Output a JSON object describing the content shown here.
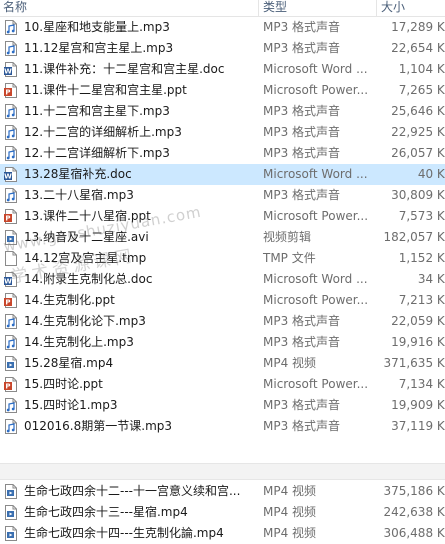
{
  "header": {
    "name": "名称",
    "type": "类型",
    "size": "大小"
  },
  "files": [
    {
      "icon": "audio",
      "name": "10.星座和地支能量上.mp3",
      "type": "MP3 格式声音",
      "size": "17,289 KB"
    },
    {
      "icon": "audio",
      "name": "11.12星宫和宫主星上.mp3",
      "type": "MP3 格式声音",
      "size": "22,654 KB"
    },
    {
      "icon": "word",
      "name": "11.课件补充：十二星宫和宫主星.doc",
      "type": "Microsoft Word ...",
      "size": "1,104 KB"
    },
    {
      "icon": "ppt",
      "name": "11.课件十二星宫和宫主星.ppt",
      "type": "Microsoft Power...",
      "size": "7,265 KB"
    },
    {
      "icon": "audio",
      "name": "11.十二宫和宫主星下.mp3",
      "type": "MP3 格式声音",
      "size": "25,646 KB"
    },
    {
      "icon": "audio",
      "name": "12.十二宫的详细解析上.mp3",
      "type": "MP3 格式声音",
      "size": "22,925 KB"
    },
    {
      "icon": "audio",
      "name": "12.十二宫详细解析下.mp3",
      "type": "MP3 格式声音",
      "size": "26,057 KB"
    },
    {
      "icon": "word",
      "name": "13.28星宿补充.doc",
      "type": "Microsoft Word ...",
      "size": "40 KB"
    },
    {
      "icon": "audio",
      "name": "13.二十八星宿.mp3",
      "type": "MP3 格式声音",
      "size": "30,809 KB"
    },
    {
      "icon": "ppt",
      "name": "13.课件二十八星宿.ppt",
      "type": "Microsoft Power...",
      "size": "7,573 KB"
    },
    {
      "icon": "video",
      "name": "13.纳音及十二星座.avi",
      "type": "视频剪辑",
      "size": "182,057 KB"
    },
    {
      "icon": "generic",
      "name": "14.12宫及宫主星.tmp",
      "type": "TMP 文件",
      "size": "1,152 KB"
    },
    {
      "icon": "word",
      "name": "14.附录生克制化总.doc",
      "type": "Microsoft Word ...",
      "size": "34 KB"
    },
    {
      "icon": "ppt",
      "name": "14.生克制化.ppt",
      "type": "Microsoft Power...",
      "size": "7,213 KB"
    },
    {
      "icon": "audio",
      "name": "14.生克制化论下.mp3",
      "type": "MP3 格式声音",
      "size": "22,059 KB"
    },
    {
      "icon": "audio",
      "name": "14.生克制化上.mp3",
      "type": "MP3 格式声音",
      "size": "19,916 KB"
    },
    {
      "icon": "video",
      "name": "15.28星宿.mp4",
      "type": "MP4 视频",
      "size": "371,635 KB"
    },
    {
      "icon": "ppt",
      "name": "15.四时论.ppt",
      "type": "Microsoft Power...",
      "size": "7,134 KB"
    },
    {
      "icon": "audio",
      "name": "15.四时论1.mp3",
      "type": "MP3 格式声音",
      "size": "19,909 KB"
    },
    {
      "icon": "audio",
      "name": "012016.8期第一节课.mp3",
      "type": "MP3 格式声音",
      "size": "37,119 KB"
    }
  ],
  "files_lower": [
    {
      "icon": "video",
      "name": "生命七政四余十二---十一宫意义续和宫...",
      "type": "MP4 视频",
      "size": "375,186 KB"
    },
    {
      "icon": "video",
      "name": "生命七政四余十三---星宿.mp4",
      "type": "MP4 视频",
      "size": "242,638 KB"
    },
    {
      "icon": "video",
      "name": "生命七政四余十四---生克制化論.mp4",
      "type": "MP4 视频",
      "size": "306,488 KB"
    }
  ],
  "watermark": {
    "line1": "www.gooshuziyuan.com",
    "line2": "学术资源课网"
  },
  "colors": {
    "selected": "#cce8ff",
    "header_text": "#4c607a",
    "meta_text": "#6d6d6d"
  }
}
